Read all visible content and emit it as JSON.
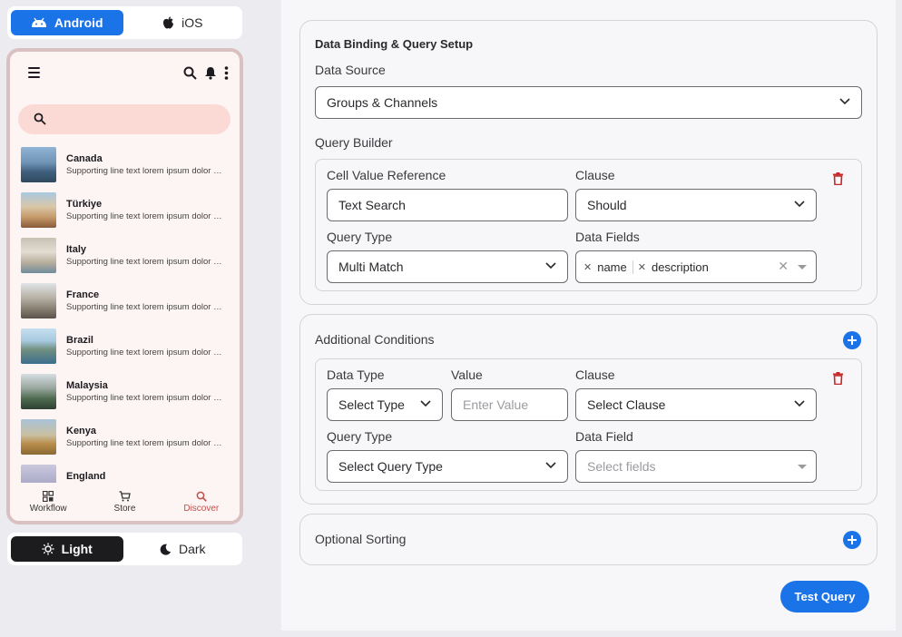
{
  "platform_toggle": {
    "android": "Android",
    "ios": "iOS",
    "active": "Android"
  },
  "theme_toggle": {
    "light": "Light",
    "dark": "Dark",
    "active": "Light"
  },
  "phone": {
    "list": [
      {
        "title": "Canada",
        "sub": "Supporting line text lorem ipsum dolor sit amet"
      },
      {
        "title": "Türkiye",
        "sub": "Supporting line text lorem ipsum dolor sit amet"
      },
      {
        "title": "Italy",
        "sub": "Supporting line text lorem ipsum dolor sit amet"
      },
      {
        "title": "France",
        "sub": "Supporting line text lorem ipsum dolor sit amet"
      },
      {
        "title": "Brazil",
        "sub": "Supporting line text lorem ipsum dolor sit amet"
      },
      {
        "title": "Malaysia",
        "sub": "Supporting line text lorem ipsum dolor sit amet"
      },
      {
        "title": "Kenya",
        "sub": "Supporting line text lorem ipsum dolor sit amet"
      },
      {
        "title": "England",
        "sub": ""
      }
    ],
    "nav": {
      "workflow": "Workflow",
      "store": "Store",
      "discover": "Discover",
      "active": "Discover"
    }
  },
  "data_binding": {
    "title": "Data Binding & Query Setup",
    "data_source_label": "Data Source",
    "data_source_value": "Groups & Channels",
    "query_builder_label": "Query Builder",
    "cell_value_label": "Cell Value Reference",
    "cell_value_value": "Text Search",
    "clause_label": "Clause",
    "clause_value": "Should",
    "query_type_label": "Query Type",
    "query_type_value": "Multi Match",
    "data_fields_label": "Data Fields",
    "data_fields": [
      "name",
      "description"
    ]
  },
  "additional": {
    "title": "Additional Conditions",
    "data_type_label": "Data Type",
    "data_type_placeholder": "Select Type",
    "value_label": "Value",
    "value_placeholder": "Enter Value",
    "clause_label": "Clause",
    "clause_placeholder": "Select Clause",
    "query_type_label": "Query Type",
    "query_type_placeholder": "Select Query Type",
    "data_field_label": "Data Field",
    "data_field_placeholder": "Select fields"
  },
  "sorting": {
    "title": "Optional Sorting"
  },
  "test_button": "Test Query",
  "colors": {
    "accent": "#1b73e8",
    "danger": "#c62828",
    "phone_frame": "#d9c1c1",
    "phone_search": "#fbdad6"
  }
}
